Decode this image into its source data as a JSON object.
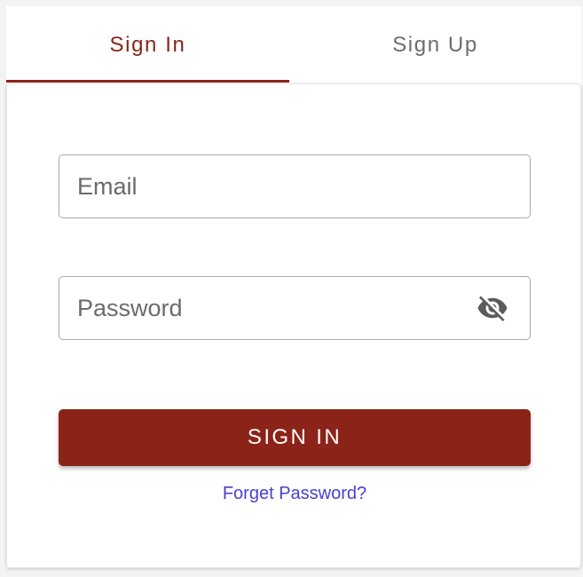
{
  "tabs": {
    "sign_in_label": "Sign In",
    "sign_up_label": "Sign Up",
    "active": "sign_in"
  },
  "form": {
    "email_placeholder": "Email",
    "email_value": "",
    "password_placeholder": "Password",
    "password_value": "",
    "password_toggle_icon": "eye-off-icon",
    "submit_label": "SIGN IN",
    "forgot_label": "Forget Password?"
  },
  "colors": {
    "brand": "#8b2318",
    "inactive_tab_text": "#6d6d6d",
    "link": "#4a3fd1",
    "input_border": "#a9a9a9"
  }
}
